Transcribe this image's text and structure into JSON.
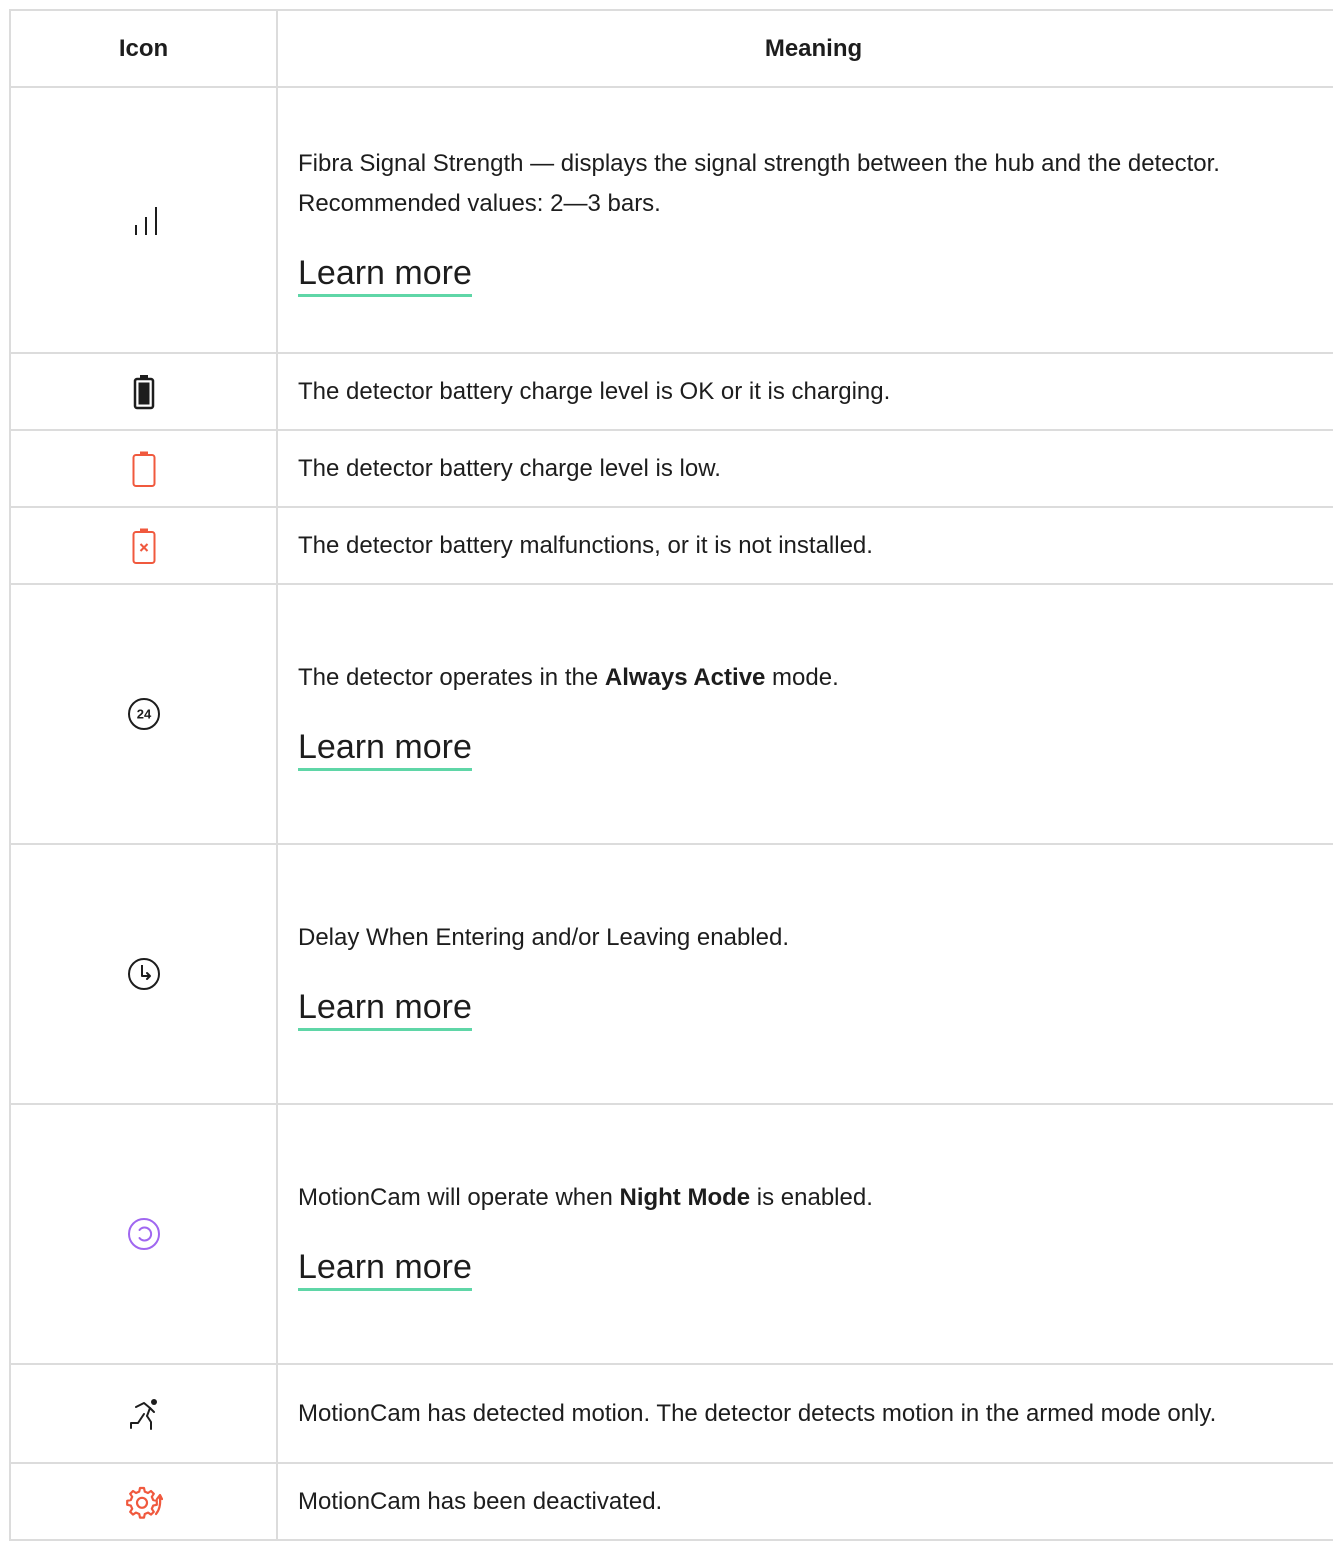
{
  "table": {
    "headers": {
      "icon": "Icon",
      "meaning": "Meaning"
    },
    "link_color": "#5fd6a7",
    "rows": [
      {
        "icon": "signal-strength-icon",
        "text": "Fibra Signal Strength — displays the signal strength between the hub and the detector. Recommended values: 2—3 bars.",
        "link": "Learn more"
      },
      {
        "icon": "battery-ok-icon",
        "text": "The detector battery charge level is OK or it is charging."
      },
      {
        "icon": "battery-low-icon",
        "icon_color": "#f0593e",
        "text": "The detector battery charge level is low."
      },
      {
        "icon": "battery-malfunction-icon",
        "icon_color": "#f0593e",
        "text": "The detector battery malfunctions, or it is not installed."
      },
      {
        "icon": "always-active-24-icon",
        "icon_label": "24",
        "text_before": "The detector operates in the ",
        "text_bold": "Always Active",
        "text_after": " mode.",
        "link": "Learn more"
      },
      {
        "icon": "delay-clock-icon",
        "text": "Delay When Entering and/or Leaving enabled.",
        "link": "Learn more"
      },
      {
        "icon": "night-mode-icon",
        "icon_color": "#a067f0",
        "text_before": "MotionCam will operate when ",
        "text_bold": "Night Mode",
        "text_after": " is enabled.",
        "link": "Learn more"
      },
      {
        "icon": "motion-detected-icon",
        "text": "MotionCam has detected motion. The detector detects motion in the armed mode only."
      },
      {
        "icon": "deactivated-gear-icon",
        "icon_color": "#f0593e",
        "text": "MotionCam has been deactivated."
      }
    ]
  }
}
